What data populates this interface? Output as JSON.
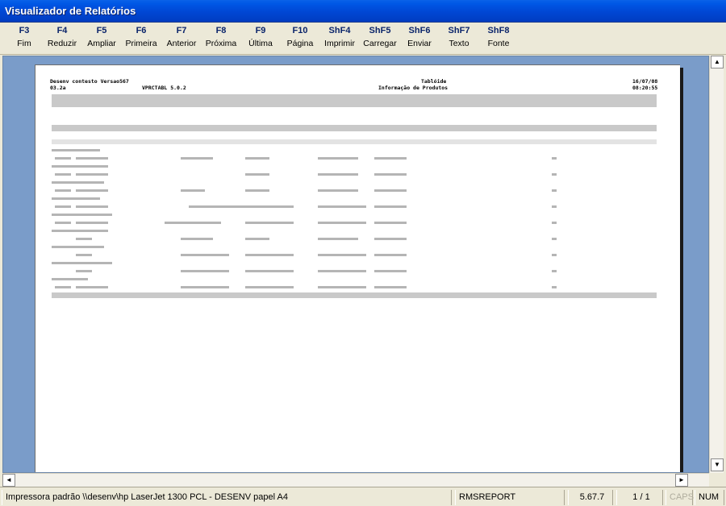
{
  "window": {
    "title": "Visualizador de Relatórios"
  },
  "fkeys": [
    {
      "key": "F3",
      "label": "Fim"
    },
    {
      "key": "F4",
      "label": "Reduzir"
    },
    {
      "key": "F5",
      "label": "Ampliar"
    },
    {
      "key": "F6",
      "label": "Primeira"
    },
    {
      "key": "F7",
      "label": "Anterior"
    },
    {
      "key": "F8",
      "label": "Próxima"
    },
    {
      "key": "F9",
      "label": "Última"
    },
    {
      "key": "F10",
      "label": "Página"
    },
    {
      "key": "ShF4",
      "label": "Imprimir"
    },
    {
      "key": "ShF5",
      "label": "Carregar"
    },
    {
      "key": "ShF6",
      "label": "Enviar"
    },
    {
      "key": "ShF7",
      "label": "Texto"
    },
    {
      "key": "ShF8",
      "label": "Fonte"
    }
  ],
  "report": {
    "company": "Desenv contesto Versao567",
    "code": "03.2a",
    "program": "VPRCTABL 5.0.2",
    "title_right": "Tablóide",
    "subtitle_right": "Informação de Produtos",
    "date": "16/07/08",
    "time": "08:20:55"
  },
  "status": {
    "printer": "Impressora padrão \\\\desenv\\hp LaserJet 1300 PCL - DESENV papel A4",
    "module": "RMSREPORT",
    "version": "5.67.7",
    "pages": "1 / 1",
    "caps": "CAPS",
    "num": "NUM"
  },
  "scroll": {
    "up_icon": "arrow-up-icon",
    "down_icon": "arrow-down-icon",
    "left_icon": "arrow-left-icon",
    "right_icon": "arrow-right-icon"
  },
  "colors": {
    "titlebar": "#0054E3",
    "fkey_key": "#0a246a",
    "viewport": "#7A9CC9"
  }
}
